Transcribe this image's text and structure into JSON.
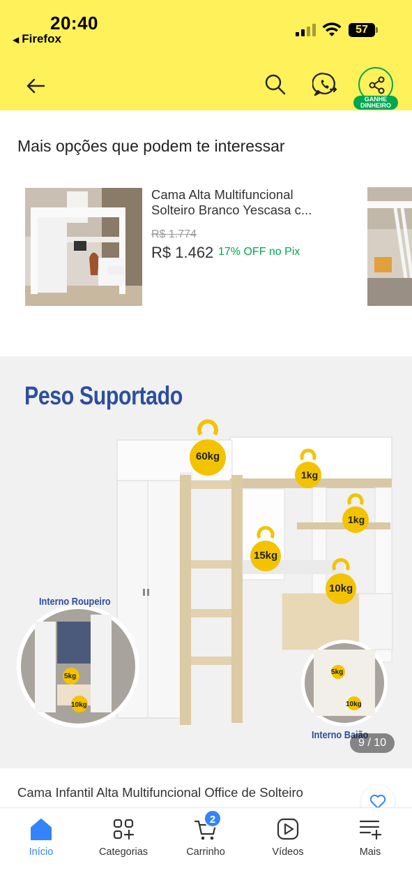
{
  "status_bar": {
    "time": "20:40",
    "back_app": "Firefox",
    "battery": "57"
  },
  "header": {
    "back_icon": "arrow-left-icon",
    "search_icon": "search-icon",
    "whatsapp_icon": "whatsapp-icon",
    "share_icon": "share-icon",
    "share_badge_line1": "GANHE",
    "share_badge_line2": "DINHEIRO",
    "background_color": "#fff159",
    "accent_color": "#00a650"
  },
  "recommendations": {
    "title": "Mais opções que podem te interessar",
    "items": [
      {
        "title": "Cama Alta Multifuncional Solteiro Branco Yescasa c...",
        "old_price": "R$ 1.774",
        "price": "R$ 1.462",
        "discount": "17% OFF no Pix"
      }
    ]
  },
  "gallery": {
    "heading": "Peso Suportado",
    "weights": {
      "w60": "60kg",
      "w1a": "1kg",
      "w1b": "1kg",
      "w15": "15kg",
      "w10": "10kg",
      "w5a": "5kg",
      "w10a": "10kg",
      "w5b": "5kg",
      "w10b": "10kg"
    },
    "label_roupeiro": "Interno Roupeiro",
    "label_baiao": "Interno Baião",
    "counter": "9 / 10"
  },
  "product": {
    "title": "Cama Infantil Alta Multifuncional Office de Solteiro",
    "favorite_icon": "heart-icon"
  },
  "tabbar": {
    "items": [
      {
        "label": "Início",
        "icon": "home-icon",
        "active": true
      },
      {
        "label": "Categorias",
        "icon": "categories-icon",
        "active": false
      },
      {
        "label": "Carrinho",
        "icon": "cart-icon",
        "active": false
      },
      {
        "label": "Vídeos",
        "icon": "play-icon",
        "active": false
      },
      {
        "label": "Mais",
        "icon": "menu-plus-icon",
        "active": false
      }
    ],
    "cart_count": "2",
    "active_color": "#3483fa"
  }
}
